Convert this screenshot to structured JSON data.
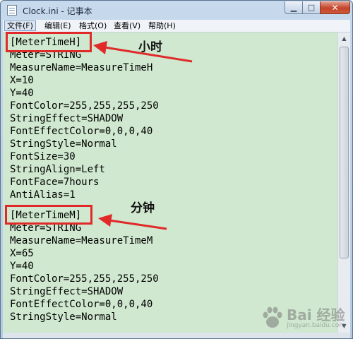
{
  "window": {
    "title": "Clock.ini - 记事本",
    "controls": {
      "minimize": "▁",
      "maximize": "□",
      "close": "✕"
    }
  },
  "menu": {
    "items": [
      {
        "label": "文件(F)",
        "active": true
      },
      {
        "label": "编辑(E)"
      },
      {
        "label": "格式(O)"
      },
      {
        "label": "查看(V)"
      },
      {
        "label": "帮助(H)"
      }
    ]
  },
  "editor": {
    "background_color": "#cfe8cf",
    "lines": [
      "[MeterTimeH]",
      "Meter=STRING",
      "MeasureName=MeasureTimeH",
      "X=10",
      "Y=40",
      "FontColor=255,255,255,250",
      "StringEffect=SHADOW",
      "FontEffectColor=0,0,0,40",
      "StringStyle=Normal",
      "FontSize=30",
      "StringAlign=Left",
      "FontFace=7hours",
      "AntiAlias=1",
      "",
      "[MeterTimeM]",
      "Meter=STRING",
      "MeasureName=MeasureTimeM",
      "X=65",
      "Y=40",
      "FontColor=255,255,255,250",
      "StringEffect=SHADOW",
      "FontEffectColor=0,0,0,40",
      "StringStyle=Normal"
    ]
  },
  "annotations": {
    "color": "#e02a2a",
    "label_hour": "小时",
    "label_minute": "分钟"
  },
  "watermark": {
    "text": "Bai 经验",
    "subtext": "jingyan.baidu.com"
  },
  "icons": {
    "app": "notepad-icon",
    "scroll_up": "scroll-up-arrow-icon",
    "scroll_down": "scroll-down-arrow-icon",
    "watermark_paw": "baidu-paw-icon"
  }
}
